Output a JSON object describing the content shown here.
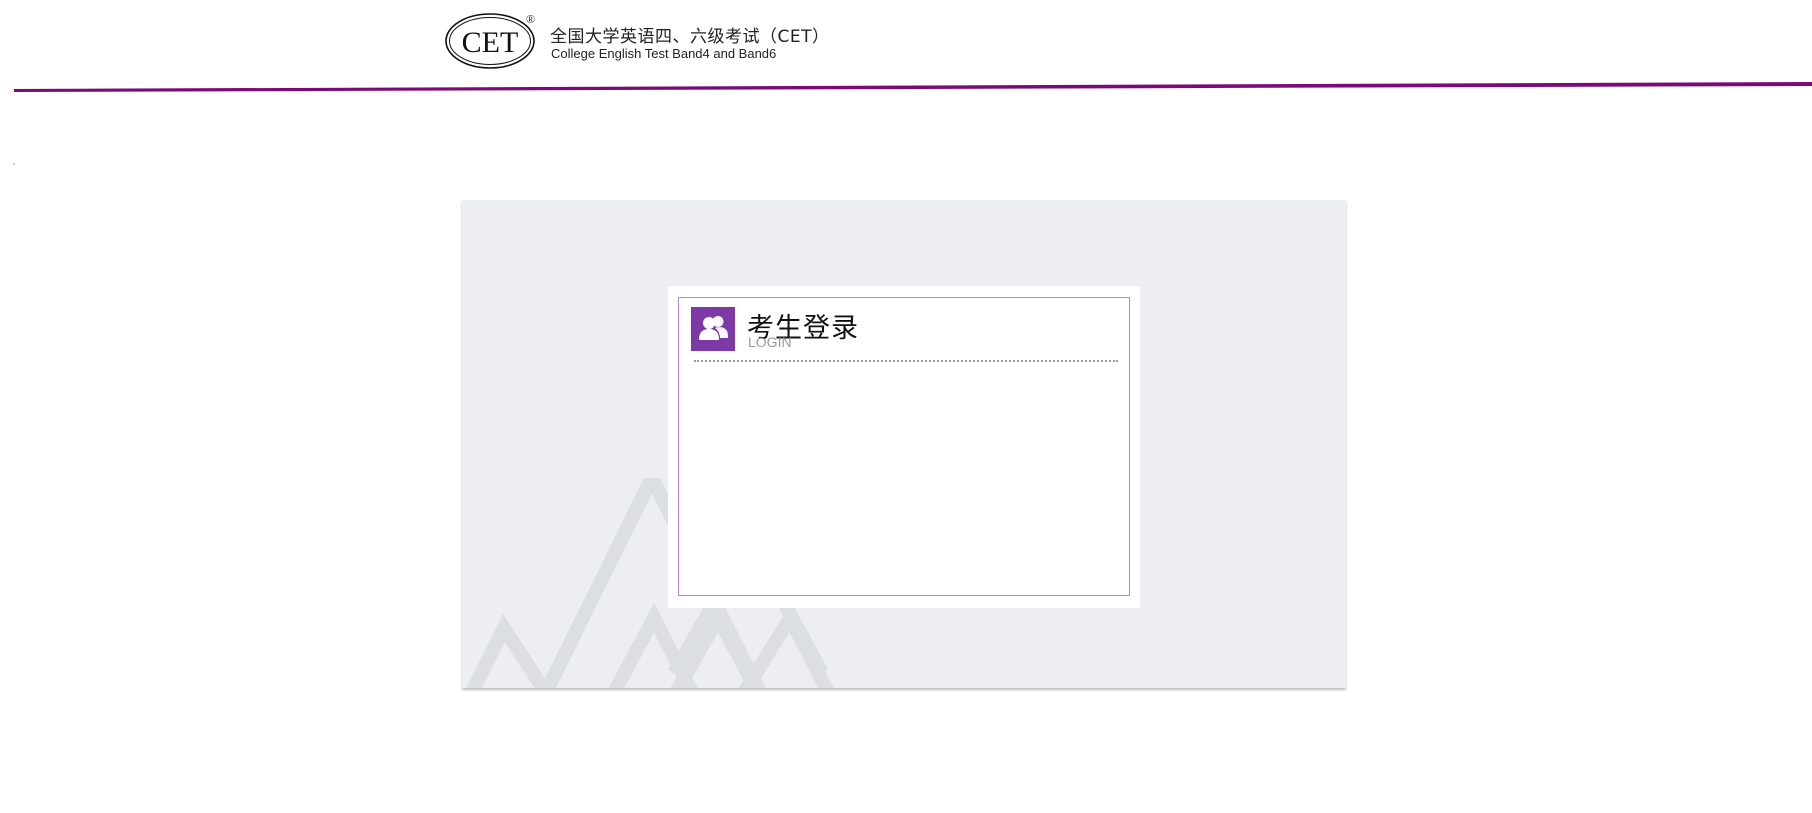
{
  "header": {
    "logo_text": "CET",
    "registered_mark": "®",
    "title": "全国大学英语四、六级考试（CET）",
    "subtitle": "College English Test Band4 and Band6"
  },
  "colors": {
    "brand_purple": "#7a0a78",
    "login_icon_bg": "#7d3aa6",
    "login_border": "#b985d4",
    "panel_bg": "#eceef1"
  },
  "login": {
    "icon": "users-icon",
    "title": "考生登录",
    "subtitle": "LOGIN"
  }
}
